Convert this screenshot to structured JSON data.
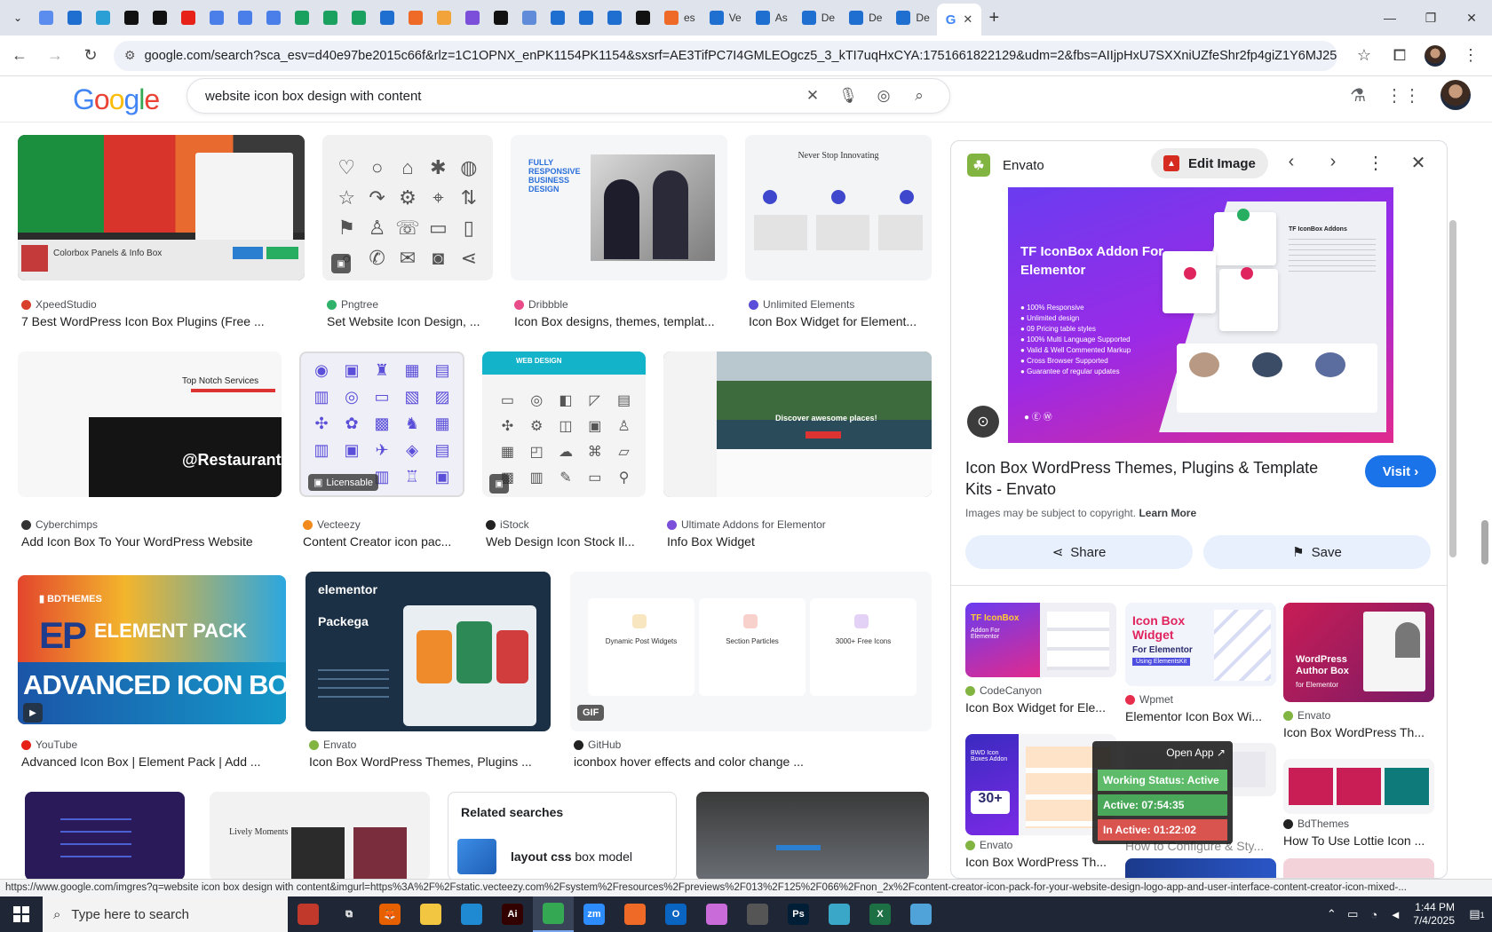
{
  "browser": {
    "tabs": [
      {
        "label": "",
        "color": "#5b8def"
      },
      {
        "label": "",
        "color": "#1f6fd1"
      },
      {
        "label": "",
        "color": "#2a9fd6"
      },
      {
        "label": "",
        "color": "#111111"
      },
      {
        "label": "",
        "color": "#111111"
      },
      {
        "label": "",
        "color": "#e62117"
      },
      {
        "label": "",
        "color": "#4a7ee8"
      },
      {
        "label": "",
        "color": "#4a7ee8"
      },
      {
        "label": "",
        "color": "#4a7ee8"
      },
      {
        "label": "",
        "color": "#1aa15f"
      },
      {
        "label": "",
        "color": "#1aa15f"
      },
      {
        "label": "",
        "color": "#1aa15f"
      },
      {
        "label": "",
        "color": "#1f6fd1"
      },
      {
        "label": "",
        "color": "#ef6a27"
      },
      {
        "label": "",
        "color": "#f2a33a"
      },
      {
        "label": "",
        "color": "#7b4fd9"
      },
      {
        "label": "",
        "color": "#111111"
      },
      {
        "label": "",
        "color": "#5f8bd8"
      },
      {
        "label": "",
        "color": "#1f6fd1"
      },
      {
        "label": "",
        "color": "#1f6fd1"
      },
      {
        "label": "",
        "color": "#1f6fd1"
      },
      {
        "label": "",
        "color": "#111111"
      },
      {
        "label": "es",
        "color": "#ef6a27"
      },
      {
        "label": "Ve",
        "color": "#1f6fd1"
      },
      {
        "label": "As",
        "color": "#1f6fd1"
      },
      {
        "label": "De",
        "color": "#1f6fd1"
      },
      {
        "label": "De",
        "color": "#1f6fd1"
      },
      {
        "label": "De",
        "color": "#1f6fd1"
      }
    ],
    "active_tab_icon": "google-icon",
    "new_tab_label": "+",
    "url": "google.com/search?sca_esv=d40e97be2015c66f&rlz=1C1OPNX_enPK1154PK1154&sxsrf=AE3TifPC7I4GMLEOgcz5_3_kTI7uqHxCYA:1751661822129&udm=2&fbs=AIIjpHxU7SXXniUZfeShr2fp4giZ1Y6MJ25_tmWITc7uy..."
  },
  "search": {
    "logo": [
      "G",
      "o",
      "o",
      "g",
      "l",
      "e"
    ],
    "query": "website icon box design with content"
  },
  "results": {
    "row1": [
      {
        "source": "XpeedStudio",
        "title": "7 Best WordPress Icon Box Plugins (Free ...",
        "fav_color": "#d9402b"
      },
      {
        "source": "Pngtree",
        "title": "Set Website Icon Design, ...",
        "fav_color": "#2fb36a"
      },
      {
        "source": "Dribbble",
        "title": "Icon Box designs, themes, templat...",
        "fav_color": "#ea4c89"
      },
      {
        "source": "Unlimited Elements",
        "title": "Icon Box Widget for Element...",
        "fav_color": "#5b4fd9"
      }
    ],
    "row2": [
      {
        "source": "Cyberchimps",
        "title": "Add Icon Box To Your WordPress Website",
        "fav_color": "#333333"
      },
      {
        "source": "Vecteezy",
        "title": "Content Creator icon pac...",
        "fav_color": "#f28a1c"
      },
      {
        "source": "iStock",
        "title": "Web Design Icon Stock Il...",
        "fav_color": "#222222"
      },
      {
        "source": "Ultimate Addons for Elementor",
        "title": "Info Box Widget",
        "fav_color": "#7b4fd9"
      }
    ],
    "row3": [
      {
        "source": "YouTube",
        "title": "Advanced Icon Box | Element Pack | Add ...",
        "fav_color": "#e62117"
      },
      {
        "source": "Envato",
        "title": "Icon Box WordPress Themes, Plugins ...",
        "fav_color": "#81b441"
      },
      {
        "source": "GitHub",
        "title": "iconbox hover effects and color change ...",
        "fav_color": "#222222"
      }
    ],
    "thumb_text": {
      "colorbox": "Colorbox Panels & Info Box",
      "restaurant": "@Restaurant",
      "top_notch": "Top Notch Services",
      "licensable": "Licensable",
      "web_design": "WEB DESIGN",
      "discover": "Discover awesome places!",
      "never_stop": "Never Stop Innovating",
      "element_pack": "ELEMENT PACK",
      "advanced": "ADVANCED ICON BOX",
      "elementor": "elementor",
      "packega": "Packega",
      "gif": "GIF",
      "dyn1": "Dynamic Post Widgets",
      "dyn2": "Section Particles",
      "dyn3": "3000+ Free Icons",
      "lively": "Lively Moments"
    },
    "related": {
      "heading": "Related searches",
      "item_prefix": "layout css",
      "item_suffix": "box model"
    }
  },
  "panel": {
    "source": "Envato",
    "edit_image": "Edit Image",
    "hero_title": "TF IconBox Addon For Elementor",
    "hero_bullets": [
      "100% Responsive",
      "Unlimited design",
      "09 Pricing table styles",
      "100% Multi Language Supported",
      "Valid & Well Commented Markup",
      "Cross Browser Supported",
      "Guarantee of regular updates"
    ],
    "hero_card_title": "TF IconBox Addons",
    "title": "Icon Box WordPress Themes, Plugins & Template Kits - Envato",
    "visit": "Visit",
    "copyright": "Images may be subject to copyright.",
    "learn_more": "Learn More",
    "share": "Share",
    "save": "Save",
    "related": [
      {
        "source": "CodeCanyon",
        "title": "Icon Box Widget for Ele...",
        "fav_color": "#81b441"
      },
      {
        "source": "Wpmet",
        "title": "Elementor Icon Box Wi...",
        "fav_color": "#e62e4d"
      },
      {
        "source": "Envato",
        "title": "Icon Box WordPress Th...",
        "fav_color": "#81b441"
      },
      {
        "source": "Envato",
        "title": "Icon Box WordPress Th...",
        "fav_color": "#81b441"
      },
      {
        "source": "",
        "title": "How to Configure & Sty...",
        "fav_color": "#e62e4d"
      },
      {
        "source": "BdThemes",
        "title": "How To Use Lottie Icon ...",
        "fav_color": "#222222"
      }
    ],
    "thumb_text": {
      "t1": "TF IconBox",
      "t1b": "Addon For Elementor",
      "t2": "Icon Box Widget",
      "t2b": "For Elementor",
      "t2c": "Using ElementsKit",
      "t3": "WordPress Author Box",
      "t3b": "for Elementor",
      "t4": "30+",
      "t4b": "BWD Icon Boxes Addon"
    }
  },
  "overlay": {
    "open_app": "Open App ↗",
    "status": "Working Status: Active",
    "active": "Active: 07:54:35",
    "inactive": "In Active: 01:22:02"
  },
  "statusbar": {
    "url": "https://www.google.com/imgres?q=website icon box design with content&imgurl=https%3A%2F%2Fstatic.vecteezy.com%2Fsystem%2Fresources%2Fpreviews%2F013%2F125%2F066%2Fnon_2x%2Fcontent-creator-icon-pack-for-your-website-design-logo-app-and-user-interface-content-creator-icon-mixed-..."
  },
  "taskbar": {
    "search_placeholder": "Type here to search",
    "apps": [
      {
        "name": "app-patriot",
        "label": "",
        "color": "#c0392b"
      },
      {
        "name": "app-taskview",
        "label": "⧉",
        "color": "#1f2737"
      },
      {
        "name": "app-firefox",
        "label": "🦊",
        "color": "#e66000"
      },
      {
        "name": "app-explorer",
        "label": "",
        "color": "#f2c641"
      },
      {
        "name": "app-vscode",
        "label": "",
        "color": "#1f8ad2"
      },
      {
        "name": "app-illustrator",
        "label": "Ai",
        "color": "#330000"
      },
      {
        "name": "app-chrome",
        "label": "",
        "color": "#34a853"
      },
      {
        "name": "app-zoom",
        "label": "zm",
        "color": "#2d8cff"
      },
      {
        "name": "app-hive",
        "label": "",
        "color": "#ef6a27"
      },
      {
        "name": "app-outlook",
        "label": "O",
        "color": "#0a64c2"
      },
      {
        "name": "app-paint",
        "label": "",
        "color": "#c96bd9"
      },
      {
        "name": "app-pen",
        "label": "",
        "color": "#555555"
      },
      {
        "name": "app-photoshop",
        "label": "Ps",
        "color": "#001e36"
      },
      {
        "name": "app-cube",
        "label": "",
        "color": "#3aa7c9"
      },
      {
        "name": "app-excel",
        "label": "X",
        "color": "#1d7044"
      },
      {
        "name": "app-notepad",
        "label": "",
        "color": "#4fa3d9"
      }
    ],
    "time": "1:44 PM",
    "date": "7/4/2025",
    "notif_count": "1"
  }
}
